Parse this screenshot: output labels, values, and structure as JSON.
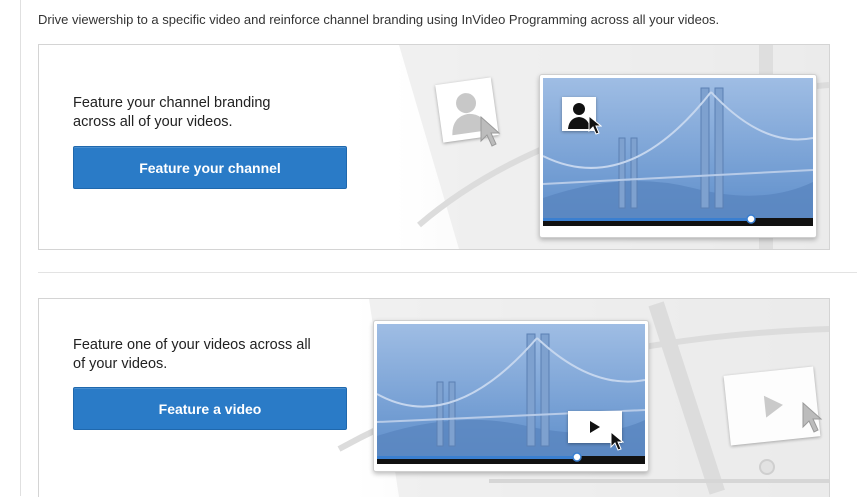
{
  "intro": "Drive viewership to a specific video and reinforce channel branding using InVideo Programming across all your videos.",
  "channel_card": {
    "description_line1": "Feature your channel branding",
    "description_line2": "across all of your videos.",
    "button_label": "Feature your channel"
  },
  "video_card": {
    "description_line1": "Feature one of your videos across all",
    "description_line2": "of your videos.",
    "button_label": "Feature a video"
  },
  "colors": {
    "button_blue": "#2a7bc7",
    "sky_blue": "#7fa6d6",
    "progress_blue": "#3a7fd0"
  },
  "icons": [
    "person-icon",
    "cursor-icon",
    "play-icon",
    "bridge-illustration"
  ]
}
